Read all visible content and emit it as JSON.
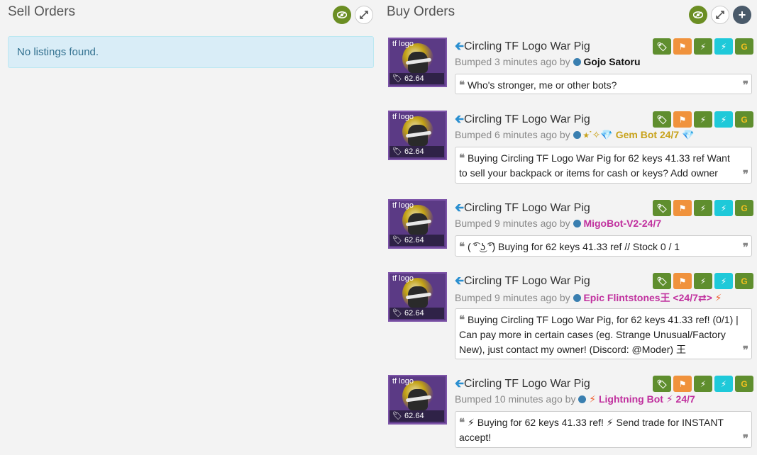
{
  "sell": {
    "title": "Sell Orders",
    "empty": "No listings found."
  },
  "buy": {
    "title": "Buy Orders",
    "listings": [
      {
        "item": "Circling TF Logo War Pig",
        "thumb_label": "tf logo",
        "price": "62.64 keys",
        "bumped": "Bumped 3 minutes ago by",
        "user": "Gojo Satoru",
        "message": "Who's stronger, me or other bots?"
      },
      {
        "item": "Circling TF Logo War Pig",
        "thumb_label": "tf logo",
        "price": "62.64 keys",
        "bumped": "Bumped 6 minutes ago by",
        "user": "⭑˙✧💎 Gem Bot 24/7 💎",
        "message": "Buying Circling TF Logo War Pig for 62 keys 41.33 ref Want to sell your backpack or items for cash or keys? Add owner"
      },
      {
        "item": "Circling TF Logo War Pig",
        "thumb_label": "tf logo",
        "price": "62.64 keys",
        "bumped": "Bumped 9 minutes ago by",
        "user": "MigoBot-V2-24/7",
        "message": "( ͡° ͜ʖ ͡°) Buying for 62 keys 41.33 ref // Stock 0 / 1"
      },
      {
        "item": "Circling TF Logo War Pig",
        "thumb_label": "tf logo",
        "price": "62.64 keys",
        "bumped": "Bumped 9 minutes ago by",
        "user": "Epic Flintstones王 <24/7⇄>",
        "message": "Buying Circling TF Logo War Pig, for 62 keys 41.33 ref! (0/1) | Can pay more in certain cases (eg. Strange Unusual/Factory New), just contact my owner! (Discord: @Moder) 王"
      },
      {
        "item": "Circling TF Logo War Pig",
        "thumb_label": "tf logo",
        "price": "62.64 keys",
        "bumped": "Bumped 10 minutes ago by",
        "user_prefix": "⚡",
        "user": "Lightning Bot",
        "user_suffix": "⚡ 24/7",
        "message_a": "⚡ Buying for 62 keys 41.33 ref!",
        "message_b": "⚡ Send trade for INSTANT accept!"
      }
    ]
  },
  "icons": {
    "eye": "👁",
    "expand": "⤢",
    "plus": "+",
    "tag": "🏷",
    "flag": "⚑",
    "bolt": "⚡",
    "g": "G",
    "quote_open": "❝",
    "quote_close": "❞",
    "arrow": "🡰"
  },
  "colors": {
    "user_0": "#111111",
    "user_1": "#c8a21a",
    "user_2": "#c0309e",
    "user_3": "#c0309e",
    "user_4": "#c0309e"
  }
}
